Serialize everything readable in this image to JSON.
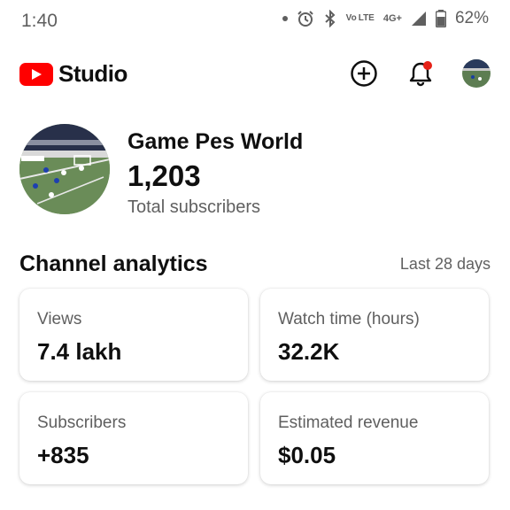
{
  "status_bar": {
    "time": "1:40",
    "volte": "Vo LTE",
    "network": "4G+",
    "battery": "62%"
  },
  "app_bar": {
    "logo_text": "Studio",
    "brand_color": "#ff0000",
    "notification_dot_color": "#e62117"
  },
  "channel": {
    "name": "Game Pes World",
    "subscriber_count": "1,203",
    "subscriber_label": "Total subscribers"
  },
  "analytics": {
    "title": "Channel analytics",
    "range": "Last 28 days",
    "cards": [
      {
        "label": "Views",
        "value": "7.4 lakh"
      },
      {
        "label": "Watch time (hours)",
        "value": "32.2K"
      },
      {
        "label": "Subscribers",
        "value": "+835"
      },
      {
        "label": "Estimated revenue",
        "value": "$0.05"
      }
    ]
  }
}
